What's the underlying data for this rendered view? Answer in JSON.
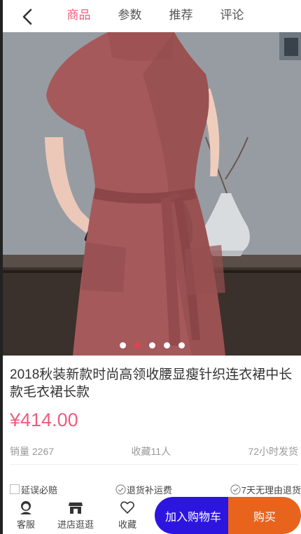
{
  "header": {
    "tabs": [
      {
        "label": "商品",
        "active": true
      },
      {
        "label": "参数",
        "active": false
      },
      {
        "label": "推荐",
        "active": false
      },
      {
        "label": "评论",
        "active": false
      }
    ]
  },
  "carousel": {
    "image": "pink-knit-sweater-dress-photo",
    "slide_count": 5,
    "active_index": 1
  },
  "product": {
    "title": "2018秋装新款时尚高领收腰显瘦针织连衣裙中长款毛衣裙长款",
    "price": "¥414.00"
  },
  "stats": {
    "sales": "销量 2267",
    "favorites": "收藏11人",
    "shipping": "72小时发货"
  },
  "guarantees": [
    {
      "label": "延误必赔",
      "icon": "checkbox-icon"
    },
    {
      "label": "退货补运费",
      "icon": "check-circle-icon"
    },
    {
      "label": "7天无理由退货",
      "icon": "check-circle-icon"
    }
  ],
  "bottom_bar": {
    "service": "客服",
    "shop": "进店逛逛",
    "favorite": "收藏",
    "add_to_cart": "加入购物车",
    "buy": "购买"
  },
  "colors": {
    "accent_pink": "#ef5d7e",
    "cart_button": "#2d15e0",
    "buy_button": "#e8641d",
    "active_dot": "#e0434e"
  }
}
